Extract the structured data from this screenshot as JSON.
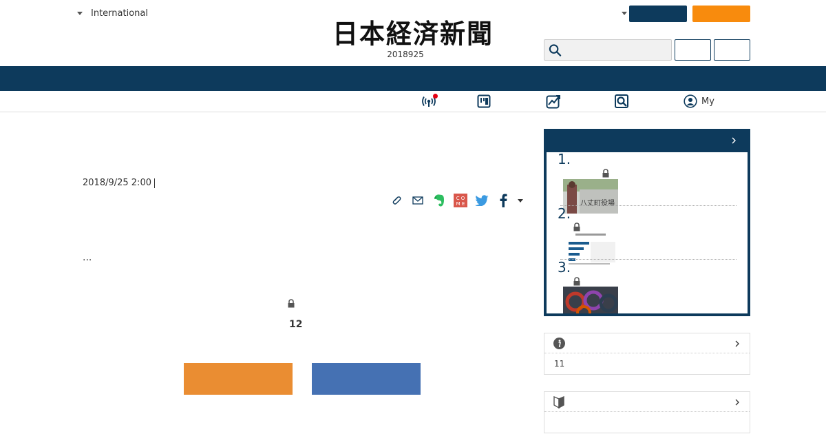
{
  "header": {
    "edition_label": "International",
    "logo_text": "日本経済新聞",
    "date": "2018925",
    "search": {
      "placeholder": ""
    }
  },
  "subnav": {
    "my_label": "My"
  },
  "article": {
    "date": "2018/9/25 2:00",
    "ellipsis": "...",
    "count": "12"
  },
  "sidebar": {
    "ranking": [
      {
        "num": "1."
      },
      {
        "num": "2."
      },
      {
        "num": "3."
      }
    ],
    "info_box_1": {
      "body": "11"
    },
    "info_box_2": {
      "body": ""
    }
  },
  "colors": {
    "navy": "#0d3a5c",
    "orange": "#f88b0d",
    "cta_orange": "#ea8d32",
    "cta_blue": "#4571b3",
    "alert_red": "#e50012"
  }
}
